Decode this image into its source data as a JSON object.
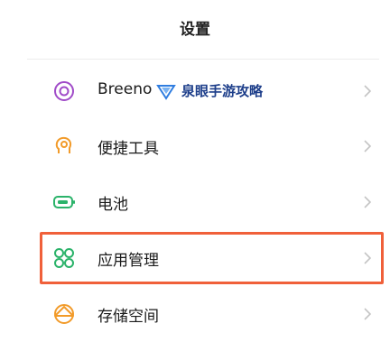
{
  "header": {
    "title": "设置"
  },
  "items": [
    {
      "label": "Breeno",
      "icon": "breeno-icon"
    },
    {
      "label": "便捷工具",
      "icon": "convenience-tools-icon"
    },
    {
      "label": "电池",
      "icon": "battery-icon"
    },
    {
      "label": "应用管理",
      "icon": "app-management-icon"
    },
    {
      "label": "存储空间",
      "icon": "storage-icon"
    }
  ],
  "watermark": {
    "text": "泉眼手游攻略"
  },
  "colors": {
    "accent": "#f0603a",
    "icon_purple": "#a04bc8",
    "icon_orange": "#f29b2a",
    "icon_green": "#2bb36a",
    "chevron": "#c4c4c4"
  }
}
